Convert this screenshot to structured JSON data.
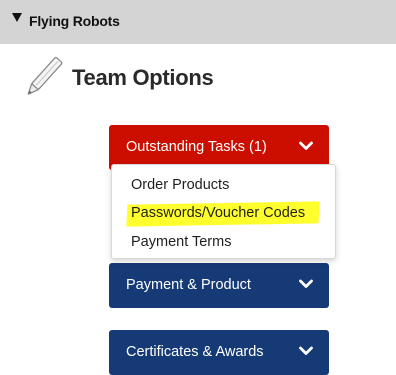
{
  "team_header": {
    "name": "Flying Robots",
    "caret_icon": "caret-down-icon"
  },
  "section": {
    "icon": "pen-icon",
    "title": "Team Options"
  },
  "dropdowns": [
    {
      "label": "Outstanding Tasks (1)",
      "color": "#cc0e00",
      "icon": "chevron-down-icon"
    },
    {
      "label": "Payment & Product",
      "color": "#163a75",
      "icon": "chevron-down-icon"
    },
    {
      "label": "Certificates & Awards",
      "color": "#163a75",
      "icon": "chevron-down-icon"
    }
  ],
  "menu": {
    "items": [
      {
        "label": "Order Products"
      },
      {
        "label": "Passwords/Voucher Codes",
        "highlighted": true,
        "highlight_color": "#ffff2e"
      },
      {
        "label": "Payment Terms"
      }
    ]
  }
}
